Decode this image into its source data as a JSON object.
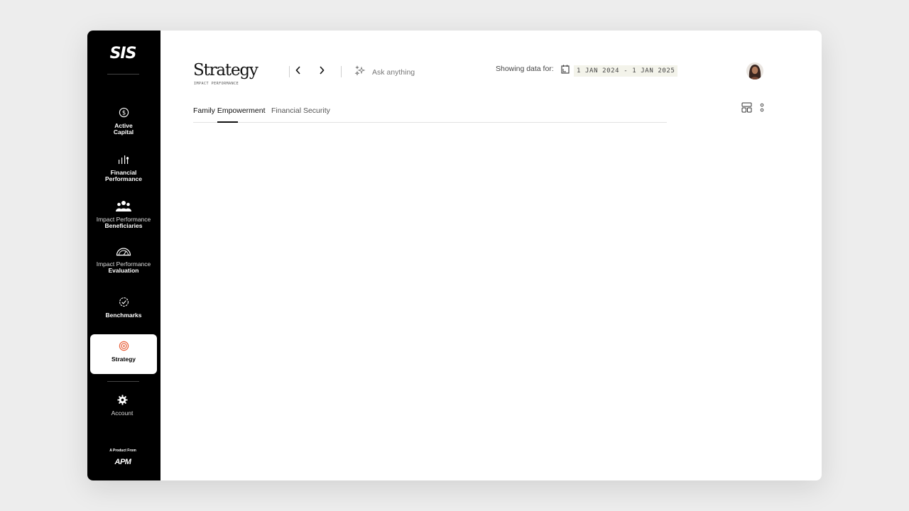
{
  "brand": {
    "logo": "SIS",
    "footer_product": "A Product From",
    "footer_brand": "APM"
  },
  "sidebar": {
    "items": [
      {
        "line1": "Active",
        "line2": "Capital",
        "icon": "dollar-circle-icon"
      },
      {
        "line1": "Financial",
        "line2": "Performance",
        "icon": "bar-chart-icon"
      },
      {
        "line1": "Impact Performance",
        "line2": "Beneficiaries",
        "icon": "people-icon"
      },
      {
        "line1": "Impact Performance",
        "line2": "Evaluation",
        "icon": "gauge-icon"
      },
      {
        "line1": "Benchmarks",
        "line2": "",
        "icon": "check-badge-icon"
      },
      {
        "line1": "Strategy",
        "line2": "",
        "icon": "target-icon",
        "active": true
      },
      {
        "line1": "Account",
        "line2": "",
        "icon": "gear-icon"
      }
    ]
  },
  "header": {
    "title": "Strategy",
    "subtitle": "IMPACT PERFORMANCE",
    "ask_placeholder": "Ask anything",
    "showing_label": "Showing data for:",
    "date_range": "1 JAN 2024 - 1 JAN 2025"
  },
  "tabs": [
    {
      "label": "Family Empowerment",
      "active": true
    },
    {
      "label": "Financial Security",
      "active": false
    }
  ],
  "colors": {
    "accent": "#e8603a",
    "sidebar_bg": "#000000",
    "chip_bg": "#f3f3ea"
  }
}
